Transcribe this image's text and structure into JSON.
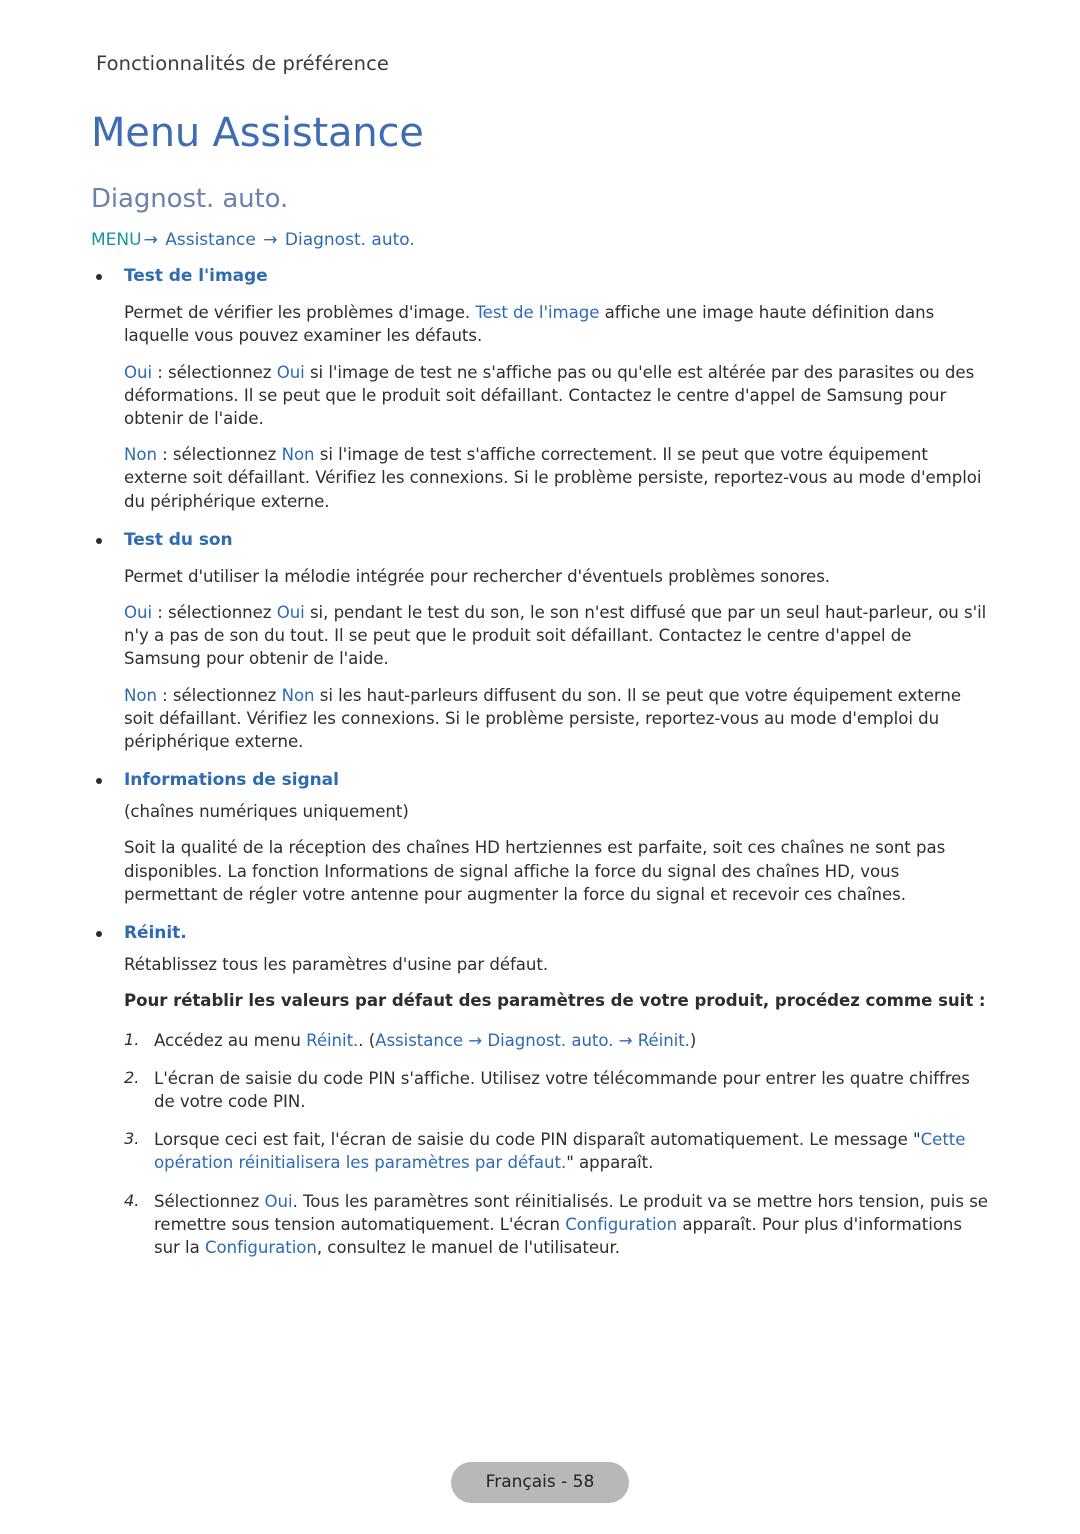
{
  "header": {
    "running_title": "Fonctionnalités de préférence"
  },
  "chapter": {
    "title": "Menu Assistance"
  },
  "section": {
    "title": "Diagnost. auto.",
    "breadcrumb": {
      "menu": "MENU",
      "arrow": "→",
      "level2": "Assistance",
      "level3": "Diagnost. auto."
    }
  },
  "bullets": {
    "test_image": {
      "label": "Test de l'image",
      "p1_a": "Permet de vérifier les problèmes d'image. ",
      "p1_hl": "Test de l'image",
      "p1_b": " affiche une image haute définition dans laquelle vous pouvez examiner les défauts.",
      "p2_hl1": "Oui",
      "p2_a": " : sélectionnez ",
      "p2_hl2": "Oui",
      "p2_b": " si l'image de test ne s'affiche pas ou qu'elle est altérée par des parasites ou des déformations. Il se peut que le produit soit défaillant. Contactez le centre d'appel de Samsung pour obtenir de l'aide.",
      "p3_hl1": "Non",
      "p3_a": " : sélectionnez ",
      "p3_hl2": "Non",
      "p3_b": " si l'image de test s'affiche correctement. Il se peut que votre équipement externe soit défaillant. Vérifiez les connexions. Si le problème persiste, reportez-vous au mode d'emploi du périphérique externe."
    },
    "test_son": {
      "label": "Test du son",
      "p1": "Permet d'utiliser la mélodie intégrée pour rechercher d'éventuels problèmes sonores.",
      "p2_hl1": "Oui",
      "p2_a": " : sélectionnez ",
      "p2_hl2": "Oui",
      "p2_b": " si, pendant le test du son, le son n'est diffusé que par un seul haut-parleur, ou s'il n'y a pas de son du tout. Il se peut que le produit soit défaillant. Contactez le centre d'appel de Samsung pour obtenir de l'aide.",
      "p3_hl1": "Non",
      "p3_a": " : sélectionnez ",
      "p3_hl2": "Non",
      "p3_b": " si les haut-parleurs diffusent du son. Il se peut que votre équipement externe soit défaillant. Vérifiez les connexions. Si le problème persiste, reportez-vous au mode d'emploi du périphérique externe."
    },
    "infos_signal": {
      "label": "Informations de signal",
      "p1": "(chaînes numériques uniquement)",
      "p2": "Soit la qualité de la réception des chaînes HD hertziennes est parfaite, soit ces chaînes ne sont pas disponibles. La fonction Informations de signal affiche la force du signal des chaînes HD, vous permettant de régler votre antenne pour augmenter la force du signal et recevoir ces chaînes."
    },
    "reinit": {
      "label": "Réinit.",
      "p1": "Rétablissez tous les paramètres d'usine par défaut.",
      "p2_bold": "Pour rétablir les valeurs par défaut des paramètres de votre produit, procédez comme suit :",
      "steps": [
        {
          "num": "1.",
          "a": "Accédez au menu ",
          "hl1": "Réinit.",
          "b": ". (",
          "hl2": "Assistance",
          "arrow1": " → ",
          "hl3": "Diagnost. auto.",
          "arrow2": " → ",
          "hl4": "Réinit.",
          "c": ")"
        },
        {
          "num": "2.",
          "text": "L'écran de saisie du code PIN s'affiche. Utilisez votre télécommande pour entrer les quatre chiffres de votre code PIN."
        },
        {
          "num": "3.",
          "a": "Lorsque ceci est fait, l'écran de saisie du code PIN disparaît automatiquement. Le message \"",
          "hl1": "Cette opération réinitialisera les paramètres par défaut.",
          "b": "\" apparaît."
        },
        {
          "num": "4.",
          "a": "Sélectionnez ",
          "hl1": "Oui",
          "b": ". Tous les paramètres sont réinitialisés. Le produit va se mettre hors tension, puis se remettre sous tension automatiquement. L'écran ",
          "hl2": "Configuration",
          "c": " apparaît. Pour plus d'informations sur la ",
          "hl3": "Configuration",
          "d": ", consultez le manuel de l'utilisateur."
        }
      ]
    }
  },
  "footer": {
    "page_label": "Français - 58"
  },
  "colors": {
    "chapter_blue": "#3f6cb3",
    "section_blue": "#6d80b2",
    "link_blue": "#2f6bb2",
    "menu_teal": "#17989b",
    "body_text": "#2e2e2e",
    "header_text": "#3b3b3b",
    "footer_pill_bg": "#b8b8b8"
  }
}
